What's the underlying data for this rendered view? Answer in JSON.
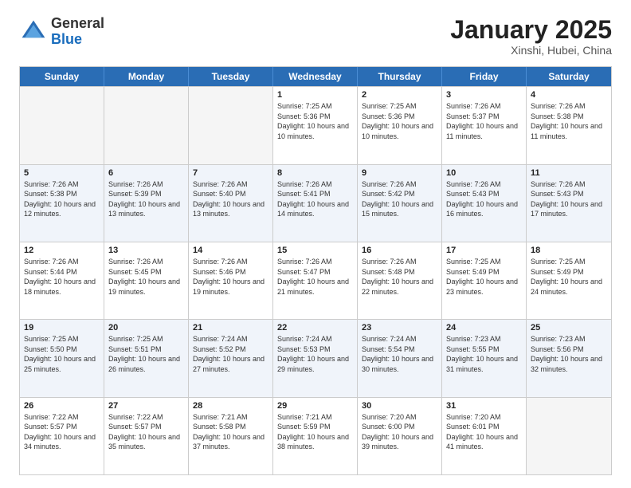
{
  "logo": {
    "general": "General",
    "blue": "Blue"
  },
  "header": {
    "title": "January 2025",
    "subtitle": "Xinshi, Hubei, China"
  },
  "weekdays": [
    "Sunday",
    "Monday",
    "Tuesday",
    "Wednesday",
    "Thursday",
    "Friday",
    "Saturday"
  ],
  "rows": [
    [
      {
        "num": "",
        "sunrise": "",
        "sunset": "",
        "daylight": "",
        "empty": true
      },
      {
        "num": "",
        "sunrise": "",
        "sunset": "",
        "daylight": "",
        "empty": true
      },
      {
        "num": "",
        "sunrise": "",
        "sunset": "",
        "daylight": "",
        "empty": true
      },
      {
        "num": "1",
        "sunrise": "Sunrise: 7:25 AM",
        "sunset": "Sunset: 5:36 PM",
        "daylight": "Daylight: 10 hours and 10 minutes."
      },
      {
        "num": "2",
        "sunrise": "Sunrise: 7:25 AM",
        "sunset": "Sunset: 5:36 PM",
        "daylight": "Daylight: 10 hours and 10 minutes."
      },
      {
        "num": "3",
        "sunrise": "Sunrise: 7:26 AM",
        "sunset": "Sunset: 5:37 PM",
        "daylight": "Daylight: 10 hours and 11 minutes."
      },
      {
        "num": "4",
        "sunrise": "Sunrise: 7:26 AM",
        "sunset": "Sunset: 5:38 PM",
        "daylight": "Daylight: 10 hours and 11 minutes."
      }
    ],
    [
      {
        "num": "5",
        "sunrise": "Sunrise: 7:26 AM",
        "sunset": "Sunset: 5:38 PM",
        "daylight": "Daylight: 10 hours and 12 minutes."
      },
      {
        "num": "6",
        "sunrise": "Sunrise: 7:26 AM",
        "sunset": "Sunset: 5:39 PM",
        "daylight": "Daylight: 10 hours and 13 minutes."
      },
      {
        "num": "7",
        "sunrise": "Sunrise: 7:26 AM",
        "sunset": "Sunset: 5:40 PM",
        "daylight": "Daylight: 10 hours and 13 minutes."
      },
      {
        "num": "8",
        "sunrise": "Sunrise: 7:26 AM",
        "sunset": "Sunset: 5:41 PM",
        "daylight": "Daylight: 10 hours and 14 minutes."
      },
      {
        "num": "9",
        "sunrise": "Sunrise: 7:26 AM",
        "sunset": "Sunset: 5:42 PM",
        "daylight": "Daylight: 10 hours and 15 minutes."
      },
      {
        "num": "10",
        "sunrise": "Sunrise: 7:26 AM",
        "sunset": "Sunset: 5:43 PM",
        "daylight": "Daylight: 10 hours and 16 minutes."
      },
      {
        "num": "11",
        "sunrise": "Sunrise: 7:26 AM",
        "sunset": "Sunset: 5:43 PM",
        "daylight": "Daylight: 10 hours and 17 minutes."
      }
    ],
    [
      {
        "num": "12",
        "sunrise": "Sunrise: 7:26 AM",
        "sunset": "Sunset: 5:44 PM",
        "daylight": "Daylight: 10 hours and 18 minutes."
      },
      {
        "num": "13",
        "sunrise": "Sunrise: 7:26 AM",
        "sunset": "Sunset: 5:45 PM",
        "daylight": "Daylight: 10 hours and 19 minutes."
      },
      {
        "num": "14",
        "sunrise": "Sunrise: 7:26 AM",
        "sunset": "Sunset: 5:46 PM",
        "daylight": "Daylight: 10 hours and 19 minutes."
      },
      {
        "num": "15",
        "sunrise": "Sunrise: 7:26 AM",
        "sunset": "Sunset: 5:47 PM",
        "daylight": "Daylight: 10 hours and 21 minutes."
      },
      {
        "num": "16",
        "sunrise": "Sunrise: 7:26 AM",
        "sunset": "Sunset: 5:48 PM",
        "daylight": "Daylight: 10 hours and 22 minutes."
      },
      {
        "num": "17",
        "sunrise": "Sunrise: 7:25 AM",
        "sunset": "Sunset: 5:49 PM",
        "daylight": "Daylight: 10 hours and 23 minutes."
      },
      {
        "num": "18",
        "sunrise": "Sunrise: 7:25 AM",
        "sunset": "Sunset: 5:49 PM",
        "daylight": "Daylight: 10 hours and 24 minutes."
      }
    ],
    [
      {
        "num": "19",
        "sunrise": "Sunrise: 7:25 AM",
        "sunset": "Sunset: 5:50 PM",
        "daylight": "Daylight: 10 hours and 25 minutes."
      },
      {
        "num": "20",
        "sunrise": "Sunrise: 7:25 AM",
        "sunset": "Sunset: 5:51 PM",
        "daylight": "Daylight: 10 hours and 26 minutes."
      },
      {
        "num": "21",
        "sunrise": "Sunrise: 7:24 AM",
        "sunset": "Sunset: 5:52 PM",
        "daylight": "Daylight: 10 hours and 27 minutes."
      },
      {
        "num": "22",
        "sunrise": "Sunrise: 7:24 AM",
        "sunset": "Sunset: 5:53 PM",
        "daylight": "Daylight: 10 hours and 29 minutes."
      },
      {
        "num": "23",
        "sunrise": "Sunrise: 7:24 AM",
        "sunset": "Sunset: 5:54 PM",
        "daylight": "Daylight: 10 hours and 30 minutes."
      },
      {
        "num": "24",
        "sunrise": "Sunrise: 7:23 AM",
        "sunset": "Sunset: 5:55 PM",
        "daylight": "Daylight: 10 hours and 31 minutes."
      },
      {
        "num": "25",
        "sunrise": "Sunrise: 7:23 AM",
        "sunset": "Sunset: 5:56 PM",
        "daylight": "Daylight: 10 hours and 32 minutes."
      }
    ],
    [
      {
        "num": "26",
        "sunrise": "Sunrise: 7:22 AM",
        "sunset": "Sunset: 5:57 PM",
        "daylight": "Daylight: 10 hours and 34 minutes."
      },
      {
        "num": "27",
        "sunrise": "Sunrise: 7:22 AM",
        "sunset": "Sunset: 5:57 PM",
        "daylight": "Daylight: 10 hours and 35 minutes."
      },
      {
        "num": "28",
        "sunrise": "Sunrise: 7:21 AM",
        "sunset": "Sunset: 5:58 PM",
        "daylight": "Daylight: 10 hours and 37 minutes."
      },
      {
        "num": "29",
        "sunrise": "Sunrise: 7:21 AM",
        "sunset": "Sunset: 5:59 PM",
        "daylight": "Daylight: 10 hours and 38 minutes."
      },
      {
        "num": "30",
        "sunrise": "Sunrise: 7:20 AM",
        "sunset": "Sunset: 6:00 PM",
        "daylight": "Daylight: 10 hours and 39 minutes."
      },
      {
        "num": "31",
        "sunrise": "Sunrise: 7:20 AM",
        "sunset": "Sunset: 6:01 PM",
        "daylight": "Daylight: 10 hours and 41 minutes."
      },
      {
        "num": "",
        "sunrise": "",
        "sunset": "",
        "daylight": "",
        "empty": true
      }
    ]
  ]
}
